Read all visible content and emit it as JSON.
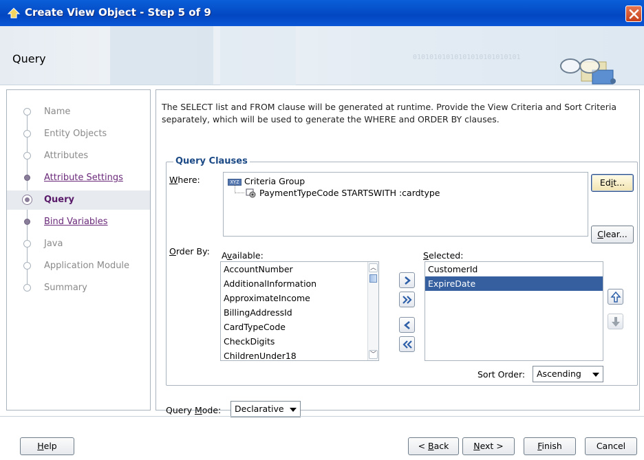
{
  "window": {
    "title": "Create View Object - Step 5 of 9",
    "close_glyph": "✕"
  },
  "header": {
    "page_title": "Query",
    "binary_decoration": "01010101010101010101010101"
  },
  "nav": {
    "items": [
      {
        "label": "Name",
        "state": "visited"
      },
      {
        "label": "Entity Objects",
        "state": "visited"
      },
      {
        "label": "Attributes",
        "state": "visited"
      },
      {
        "label": "Attribute Settings",
        "state": "link"
      },
      {
        "label": "Query",
        "state": "current"
      },
      {
        "label": "Bind Variables",
        "state": "link"
      },
      {
        "label": "Java",
        "state": "visited"
      },
      {
        "label": "Application Module",
        "state": "visited"
      },
      {
        "label": "Summary",
        "state": "visited"
      }
    ]
  },
  "main": {
    "description": "The SELECT list and FROM clause will be generated at runtime.  Provide the View Criteria and Sort Criteria separately, which will be used to generate the WHERE and ORDER BY clauses.",
    "query_clauses": {
      "title": "Query Clauses",
      "where_label_mnemonic": "W",
      "where_label_rest": "here:",
      "where_tree": {
        "root_badge": "XYZ",
        "root": "Criteria Group",
        "child": "PaymentTypeCode STARTSWITH :cardtype"
      },
      "edit_button": {
        "pre": "Ed",
        "mnemonic": "i",
        "post": "t..."
      },
      "clear_button": {
        "mnemonic": "C",
        "post": "lear..."
      },
      "order_by_label": {
        "mnemonic": "O",
        "post": "rder By:"
      },
      "available_label": {
        "pre": "A",
        "mnemonic": "v",
        "post": "ailable:"
      },
      "selected_label": {
        "mnemonic": "S",
        "post": "elected:"
      },
      "available_items": [
        "AccountNumber",
        "AdditionalInformation",
        "ApproximateIncome",
        "BillingAddressId",
        "CardTypeCode",
        "CheckDigits",
        "ChildrenUnder18"
      ],
      "selected_items": [
        "CustomerId",
        "ExpireDate"
      ],
      "selected_index": 1,
      "sort_order_label": "Sort Order:",
      "sort_order_value": "Ascending"
    },
    "query_mode": {
      "label_pre": "Query ",
      "label_mnemonic": "M",
      "label_post": "ode:",
      "value": "Declarative"
    }
  },
  "footer": {
    "help": {
      "mnemonic": "H",
      "post": "elp"
    },
    "back": {
      "pre": "< ",
      "mnemonic": "B",
      "post": "ack"
    },
    "next": {
      "mnemonic": "N",
      "post": "ext >"
    },
    "finish": {
      "mnemonic": "F",
      "post": "inish"
    },
    "cancel": "Cancel"
  },
  "icons": {
    "move_right": "chevron-right-icon",
    "move_all_right": "double-chevron-right-icon",
    "move_left": "chevron-left-icon",
    "move_all_left": "double-chevron-left-icon",
    "move_up": "arrow-up-icon",
    "move_down": "arrow-down-icon"
  },
  "colors": {
    "titlebar": "#0347c2",
    "selection": "#355f9e",
    "group_title": "#1c4a86",
    "nav_link": "#6b2a7a"
  }
}
